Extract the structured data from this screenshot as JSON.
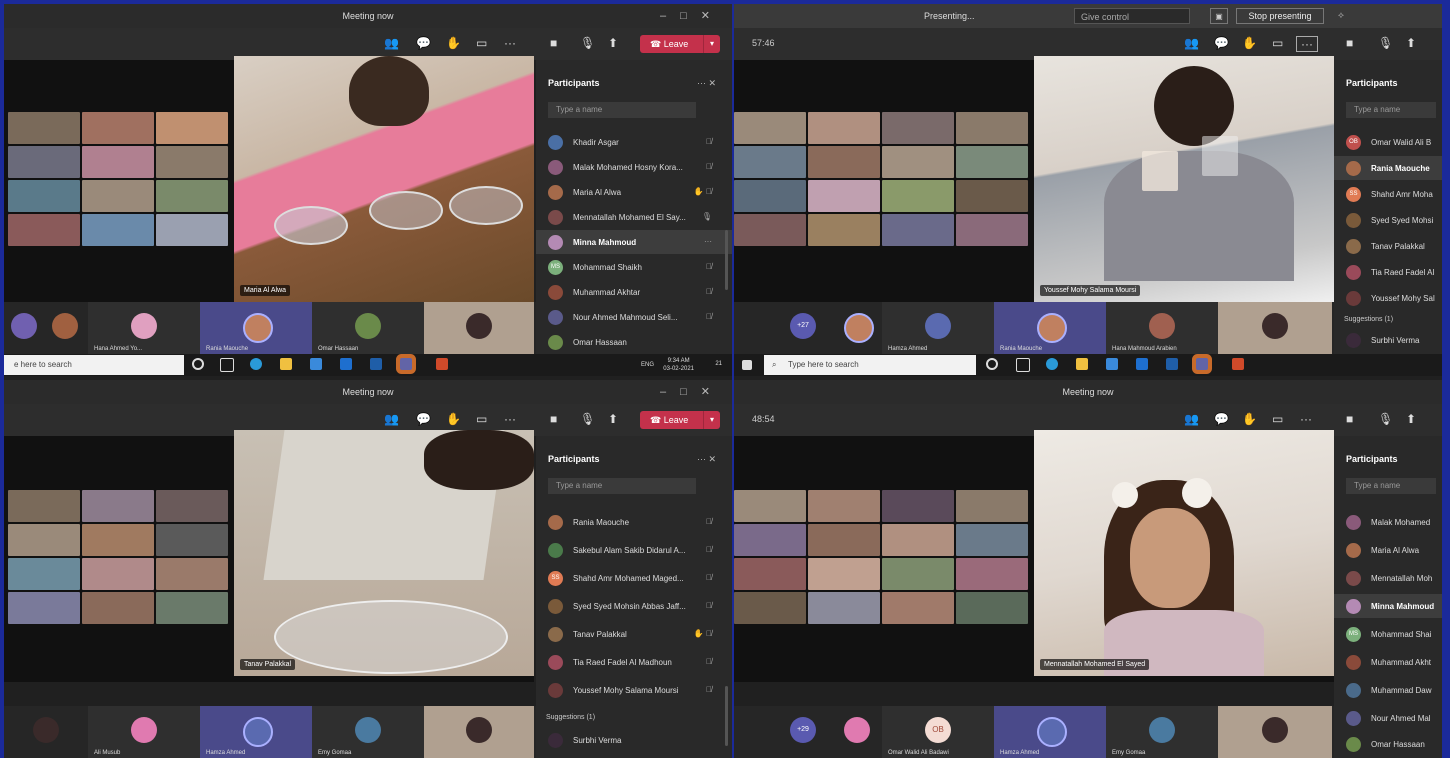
{
  "q1": {
    "title": "Meeting now",
    "leave_label": "Leave",
    "main_name": "Maria Al Alwa",
    "strip": [
      "",
      "",
      "Hana Ahmed Yo...",
      "Rania Maouche",
      "Omar Hassaan",
      ""
    ],
    "panel_title": "Participants",
    "search_placeholder": "Type a name",
    "participants": [
      {
        "name": "Khadir Asgar",
        "initials": "",
        "color": "#4a6fa5"
      },
      {
        "name": "Malak Mohamed Hosny Kora...",
        "initials": "",
        "color": "#8a5a7a"
      },
      {
        "name": "Maria Al Alwa",
        "initials": "",
        "color": "#a56a4a"
      },
      {
        "name": "Mennatallah Mohamed El Say...",
        "initials": "",
        "color": "#7a4a4a"
      },
      {
        "name": "Minna Mahmoud",
        "initials": "",
        "color": "#b48ab4"
      },
      {
        "name": "Mohammad Shaikh",
        "initials": "MS",
        "color": "#7cb07c"
      },
      {
        "name": "Muhammad Akhtar",
        "initials": "",
        "color": "#8a4a3a"
      },
      {
        "name": "Nour Ahmed Mahmoud Seli...",
        "initials": "",
        "color": "#5a5a8a"
      },
      {
        "name": "Omar Hassaan",
        "initials": "",
        "color": "#6a8a4a"
      }
    ],
    "taskbar": {
      "search": "e here to search",
      "lang": "ENG",
      "time": "9:34 AM",
      "date": "03-02-2021",
      "badge": "21"
    }
  },
  "q2": {
    "presenting": "Presenting...",
    "give_control": "Give control",
    "stop_presenting": "Stop presenting",
    "timer": "57:46",
    "main_name": "Youssef Mohy Salama Moursi",
    "strip": [
      "+27",
      "",
      "Hamza Ahmed",
      "Rania Maouche",
      "Hana Mahmoud Arabien",
      ""
    ],
    "panel_title": "Participants",
    "search_placeholder": "Type a name",
    "participants": [
      {
        "name": "Omar Walid Ali B",
        "initials": "OB",
        "color": "#c0504d"
      },
      {
        "name": "Rania Maouche",
        "initials": "",
        "color": "#a56a4a"
      },
      {
        "name": "Shahd Amr Moha",
        "initials": "SS",
        "color": "#e07b54"
      },
      {
        "name": "Syed Syed Mohsi",
        "initials": "",
        "color": "#7a5a3a"
      },
      {
        "name": "Tanav Palakkal",
        "initials": "",
        "color": "#8a6a4a"
      },
      {
        "name": "Tia Raed Fadel Al",
        "initials": "",
        "color": "#9a4a5a"
      },
      {
        "name": "Youssef Mohy Sal",
        "initials": "",
        "color": "#6a3a3a"
      }
    ],
    "suggestions": "Suggestions (1)",
    "suggestion_name": "Surbhi Verma",
    "taskbar": {
      "search": "Type here to search"
    }
  },
  "q3": {
    "title": "Meeting now",
    "leave_label": "Leave",
    "main_name": "Tanav Palakkal",
    "strip": [
      "",
      "Ali Musub",
      "Hamza Ahmed",
      "Emy Gomaa",
      ""
    ],
    "panel_title": "Participants",
    "search_placeholder": "Type a name",
    "participants": [
      {
        "name": "Rania Maouche",
        "initials": "",
        "color": "#a56a4a"
      },
      {
        "name": "Sakebul Alam Sakib Didarul A...",
        "initials": "",
        "color": "#4a7a4a"
      },
      {
        "name": "Shahd Amr Mohamed Maged...",
        "initials": "SS",
        "color": "#e07b54"
      },
      {
        "name": "Syed Syed Mohsin Abbas Jaff...",
        "initials": "",
        "color": "#7a5a3a"
      },
      {
        "name": "Tanav Palakkal",
        "initials": "",
        "color": "#8a6a4a"
      },
      {
        "name": "Tia Raed Fadel Al Madhoun",
        "initials": "",
        "color": "#9a4a5a"
      },
      {
        "name": "Youssef Mohy Salama Moursi",
        "initials": "",
        "color": "#6a3a3a"
      }
    ],
    "suggestions": "Suggestions (1)",
    "suggestion_name": "Surbhi Verma"
  },
  "q4": {
    "title": "Meeting now",
    "timer": "48:54",
    "main_name": "Mennatallah Mohamed El Sayed",
    "strip": [
      "+29",
      "",
      "Omar Walid Ali Badawi",
      "Hamza Ahmed",
      "Emy Gomaa",
      ""
    ],
    "strip_initials": "OB",
    "panel_title": "Participants",
    "search_placeholder": "Type a name",
    "participants": [
      {
        "name": "Malak Mohamed",
        "initials": "",
        "color": "#8a5a7a"
      },
      {
        "name": "Maria Al Alwa",
        "initials": "",
        "color": "#a56a4a"
      },
      {
        "name": "Mennatallah Moh",
        "initials": "",
        "color": "#7a4a4a"
      },
      {
        "name": "Minna Mahmoud",
        "initials": "",
        "color": "#b48ab4"
      },
      {
        "name": "Mohammad Shai",
        "initials": "MS",
        "color": "#7cb07c"
      },
      {
        "name": "Muhammad Akht",
        "initials": "",
        "color": "#8a4a3a"
      },
      {
        "name": "Muhammad Daw",
        "initials": "",
        "color": "#4a6a8a"
      },
      {
        "name": "Nour Ahmed Mal",
        "initials": "",
        "color": "#5a5a8a"
      },
      {
        "name": "Omar Hassaan",
        "initials": "",
        "color": "#6a8a4a"
      }
    ]
  }
}
